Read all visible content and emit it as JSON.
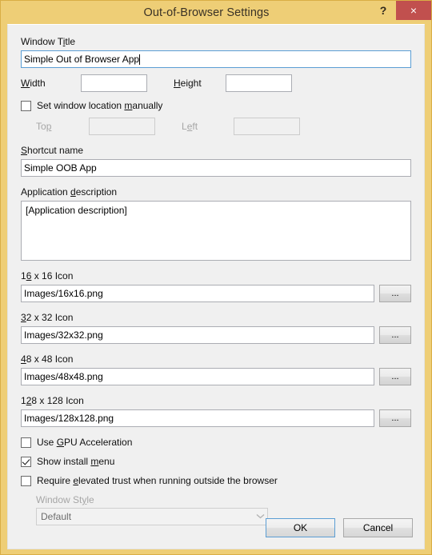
{
  "window": {
    "title": "Out-of-Browser Settings",
    "help_icon": "?",
    "close_icon": "×"
  },
  "colors": {
    "frame": "#EECE76",
    "close_button": "#C1504E",
    "panel": "#F0F0F0",
    "focus_border": "#5B9ED4",
    "field_border": "#ABADB3",
    "disabled_text": "#A6A6A6"
  },
  "form": {
    "window_title": {
      "label_pre": "Window T",
      "label_accel": "i",
      "label_post": "tle",
      "value": "Simple Out of Browser App"
    },
    "width": {
      "label_pre": "",
      "label_accel": "W",
      "label_post": "idth",
      "value": ""
    },
    "height": {
      "label_pre": "",
      "label_accel": "H",
      "label_post": "eight",
      "value": ""
    },
    "set_location": {
      "label_pre": "Set window location ",
      "label_accel": "m",
      "label_post": "anually",
      "checked": false
    },
    "top": {
      "label_pre": "To",
      "label_accel": "p",
      "label_post": "",
      "value": "",
      "disabled": true
    },
    "left": {
      "label_pre": "L",
      "label_accel": "e",
      "label_post": "ft",
      "value": "",
      "disabled": true
    },
    "shortcut_name": {
      "label_pre": "",
      "label_accel": "S",
      "label_post": "hortcut name",
      "value": "Simple OOB App"
    },
    "app_description": {
      "label_pre": "Application ",
      "label_accel": "d",
      "label_post": "escription",
      "value": "[Application description]"
    },
    "icons": [
      {
        "label_pre": "1",
        "label_accel": "6",
        "label_post": " x 16 Icon",
        "value": "Images/16x16.png",
        "browse_label": "..."
      },
      {
        "label_pre": "",
        "label_accel": "3",
        "label_post": "2 x 32 Icon",
        "value": "Images/32x32.png",
        "browse_label": "..."
      },
      {
        "label_pre": "",
        "label_accel": "4",
        "label_post": "8 x 48 Icon",
        "value": "Images/48x48.png",
        "browse_label": "..."
      },
      {
        "label_pre": "1",
        "label_accel": "2",
        "label_post": "8 x 128 Icon",
        "value": "Images/128x128.png",
        "browse_label": "..."
      }
    ],
    "gpu_acceleration": {
      "label_pre": "Use ",
      "label_accel": "G",
      "label_post": "PU Acceleration",
      "checked": false
    },
    "show_install_menu": {
      "label_pre": "Show install ",
      "label_accel": "m",
      "label_post": "enu",
      "checked": true
    },
    "elevated_trust": {
      "label_pre": "Require ",
      "label_accel": "e",
      "label_post": "levated trust when running outside the browser",
      "checked": false
    },
    "window_style": {
      "label_pre": "Window St",
      "label_accel": "y",
      "label_post": "le",
      "value": "Default",
      "arrow_icon": "⌄",
      "disabled": true,
      "options": [
        "Default"
      ]
    }
  },
  "footer": {
    "ok_label": "OK",
    "cancel_label": "Cancel"
  }
}
